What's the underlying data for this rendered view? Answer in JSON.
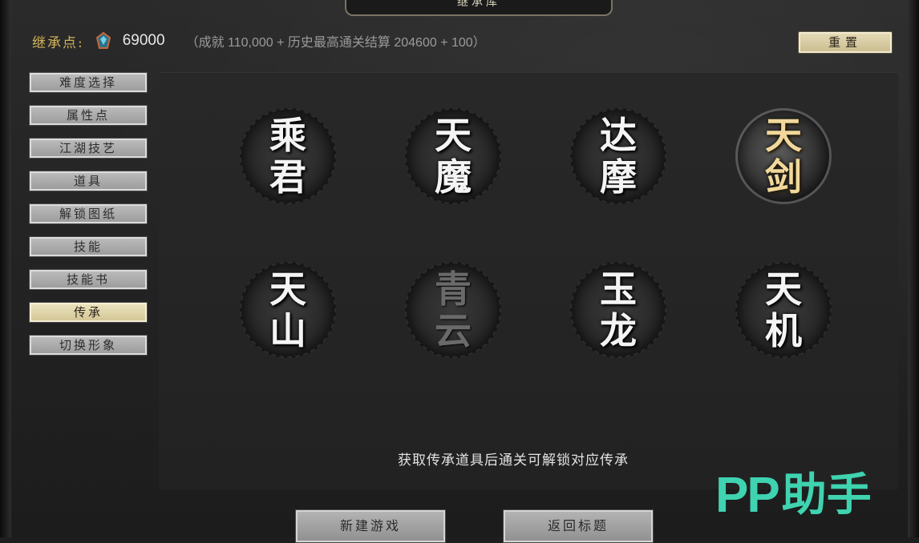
{
  "window": {
    "title": "继承库"
  },
  "header": {
    "points_label": "继承点:",
    "gem_icon": "gem-icon",
    "points_value": "69000",
    "points_detail": "（成就 110,000 + 历史最高通关结算 204600 + 100）",
    "reset_label": "重置"
  },
  "sidebar": {
    "items": [
      {
        "label": "难度选择",
        "active": false
      },
      {
        "label": "属性点",
        "active": false
      },
      {
        "label": "江湖技艺",
        "active": false
      },
      {
        "label": "道具",
        "active": false
      },
      {
        "label": "解锁图纸",
        "active": false
      },
      {
        "label": "技能",
        "active": false
      },
      {
        "label": "技能书",
        "active": false
      },
      {
        "label": "传承",
        "active": true
      },
      {
        "label": "切换形象",
        "active": false
      }
    ]
  },
  "inheritances": [
    {
      "top": "乘",
      "bottom": "君",
      "state": "unlocked"
    },
    {
      "top": "天",
      "bottom": "魔",
      "state": "unlocked"
    },
    {
      "top": "达",
      "bottom": "摩",
      "state": "unlocked"
    },
    {
      "top": "天",
      "bottom": "剑",
      "state": "selected"
    },
    {
      "top": "天",
      "bottom": "山",
      "state": "unlocked"
    },
    {
      "top": "青",
      "bottom": "云",
      "state": "locked"
    },
    {
      "top": "玉",
      "bottom": "龙",
      "state": "unlocked"
    },
    {
      "top": "天",
      "bottom": "机",
      "state": "unlocked"
    }
  ],
  "hint": "获取传承道具后通关可解锁对应传承",
  "footer": {
    "new_game_label": "新建游戏",
    "return_title_label": "返回标题"
  },
  "watermark": {
    "pp": "PP",
    "cn": "助手"
  },
  "colors": {
    "accent_gold": "#d4b45a",
    "active_tab": "#ede4c0",
    "watermark": "#3fd3b0"
  }
}
